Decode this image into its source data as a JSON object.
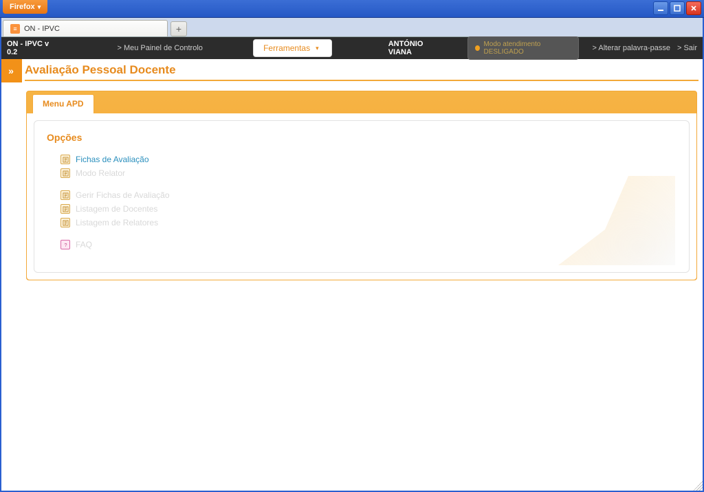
{
  "browser": {
    "name": "Firefox",
    "tab_title": "ON - IPVC"
  },
  "header": {
    "brand": "ON - IPVC v 0.2",
    "painel": "Meu Painel de Controlo",
    "ferramentas": "Ferramentas",
    "user": "ANTÓNIO VIANA",
    "modo": "Modo atendimento DESLIGADO",
    "alterar": "Alterar palavra-passe",
    "sair": "Sair"
  },
  "page": {
    "title": "Avaliação Pessoal Docente",
    "tab": "Menu APD"
  },
  "options": {
    "heading": "Opções",
    "items": {
      "fichas": "Fichas de Avaliação",
      "modo_relator": "Modo Relator",
      "gerir": "Gerir Fichas de Avaliação",
      "list_docentes": "Listagem de Docentes",
      "list_relatores": "Listagem de Relatores",
      "faq": "FAQ"
    }
  },
  "side_toggle_glyph": "»"
}
